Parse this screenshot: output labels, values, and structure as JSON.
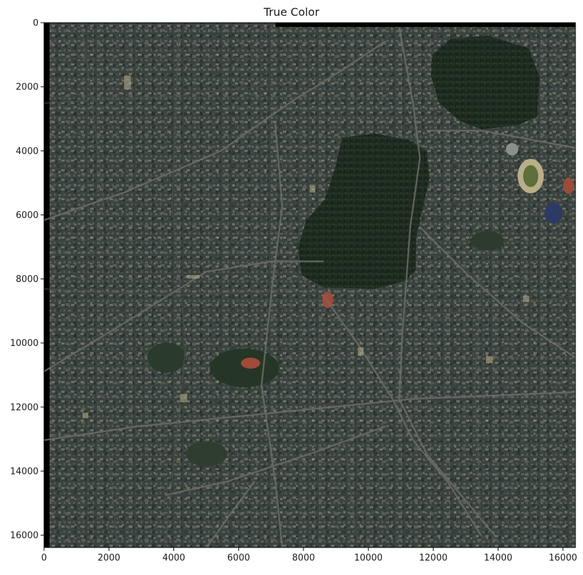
{
  "chart_data": {
    "type": "image",
    "title": "True Color",
    "xlabel": "",
    "ylabel": "",
    "xlim": [
      0,
      16384
    ],
    "ylim": [
      16384,
      0
    ],
    "x_ticks": [
      0,
      2000,
      4000,
      6000,
      8000,
      10000,
      12000,
      14000,
      16000
    ],
    "y_ticks": [
      0,
      2000,
      4000,
      6000,
      8000,
      10000,
      12000,
      14000,
      16000
    ],
    "grid": false,
    "content": "satellite imagery of a dense urban area with large wooded parks and sports stadiums",
    "colors": {
      "urban_base": "#3a423f",
      "urban_light": "#59605a",
      "forest": "#1d2a20",
      "road": "#6c6d66",
      "stadium_track": "#a24a3a",
      "stadium_field": "#5f6e3c"
    }
  }
}
